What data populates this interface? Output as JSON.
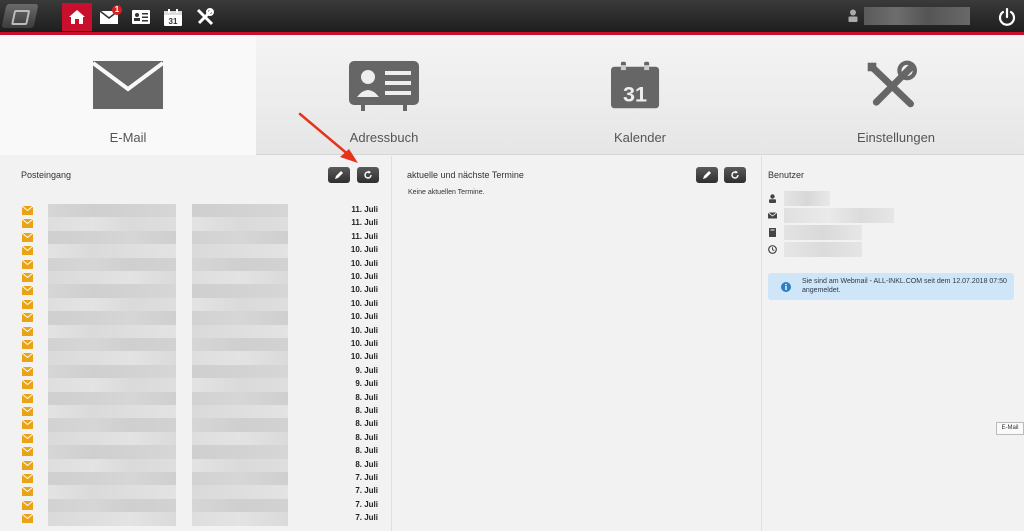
{
  "topbar": {
    "tabs": [
      {
        "name": "home",
        "icon": "home-icon"
      },
      {
        "name": "mail",
        "icon": "envelope-icon",
        "badge": "1"
      },
      {
        "name": "addressbook",
        "icon": "contact-card-icon"
      },
      {
        "name": "calendar",
        "icon": "calendar-icon",
        "day": "31"
      },
      {
        "name": "settings",
        "icon": "tools-icon"
      }
    ],
    "power_icon": "power-icon"
  },
  "modules": [
    {
      "label": "E-Mail",
      "icon": "envelope-icon",
      "active": true
    },
    {
      "label": "Adressbuch",
      "icon": "contact-card-icon"
    },
    {
      "label": "Kalender",
      "icon": "calendar-icon",
      "day": "31"
    },
    {
      "label": "Einstellungen",
      "icon": "tools-icon"
    }
  ],
  "inbox": {
    "title": "Posteingang",
    "mails": [
      {
        "date": "11. Juli"
      },
      {
        "date": "11. Juli"
      },
      {
        "date": "11. Juli"
      },
      {
        "date": "10. Juli"
      },
      {
        "date": "10. Juli"
      },
      {
        "date": "10. Juli"
      },
      {
        "date": "10. Juli"
      },
      {
        "date": "10. Juli"
      },
      {
        "date": "10. Juli"
      },
      {
        "date": "10. Juli"
      },
      {
        "date": "10. Juli"
      },
      {
        "date": "10. Juli"
      },
      {
        "date": "9. Juli"
      },
      {
        "date": "9. Juli"
      },
      {
        "date": "8. Juli"
      },
      {
        "date": "8. Juli"
      },
      {
        "date": "8. Juli"
      },
      {
        "date": "8. Juli"
      },
      {
        "date": "8. Juli"
      },
      {
        "date": "8. Juli"
      },
      {
        "date": "7. Juli"
      },
      {
        "date": "7. Juli"
      },
      {
        "date": "7. Juli"
      },
      {
        "date": "7. Juli"
      }
    ]
  },
  "appointments": {
    "title": "aktuelle und nächste Termine",
    "empty_text": "Keine aktuellen Termine."
  },
  "user": {
    "title": "Benutzer",
    "info_icons": [
      "user-icon",
      "envelope-icon",
      "book-icon",
      "clock-icon"
    ],
    "notice": "Sie sind am Webmail - ALL-INKL.COM seit dem 12.07.2018 07:50 angemeldet."
  },
  "tooltip": "E-Mail",
  "colors": {
    "accent": "#c8102e",
    "notice_bg": "#cfe5f8",
    "mail_icon": "#e8a317"
  }
}
